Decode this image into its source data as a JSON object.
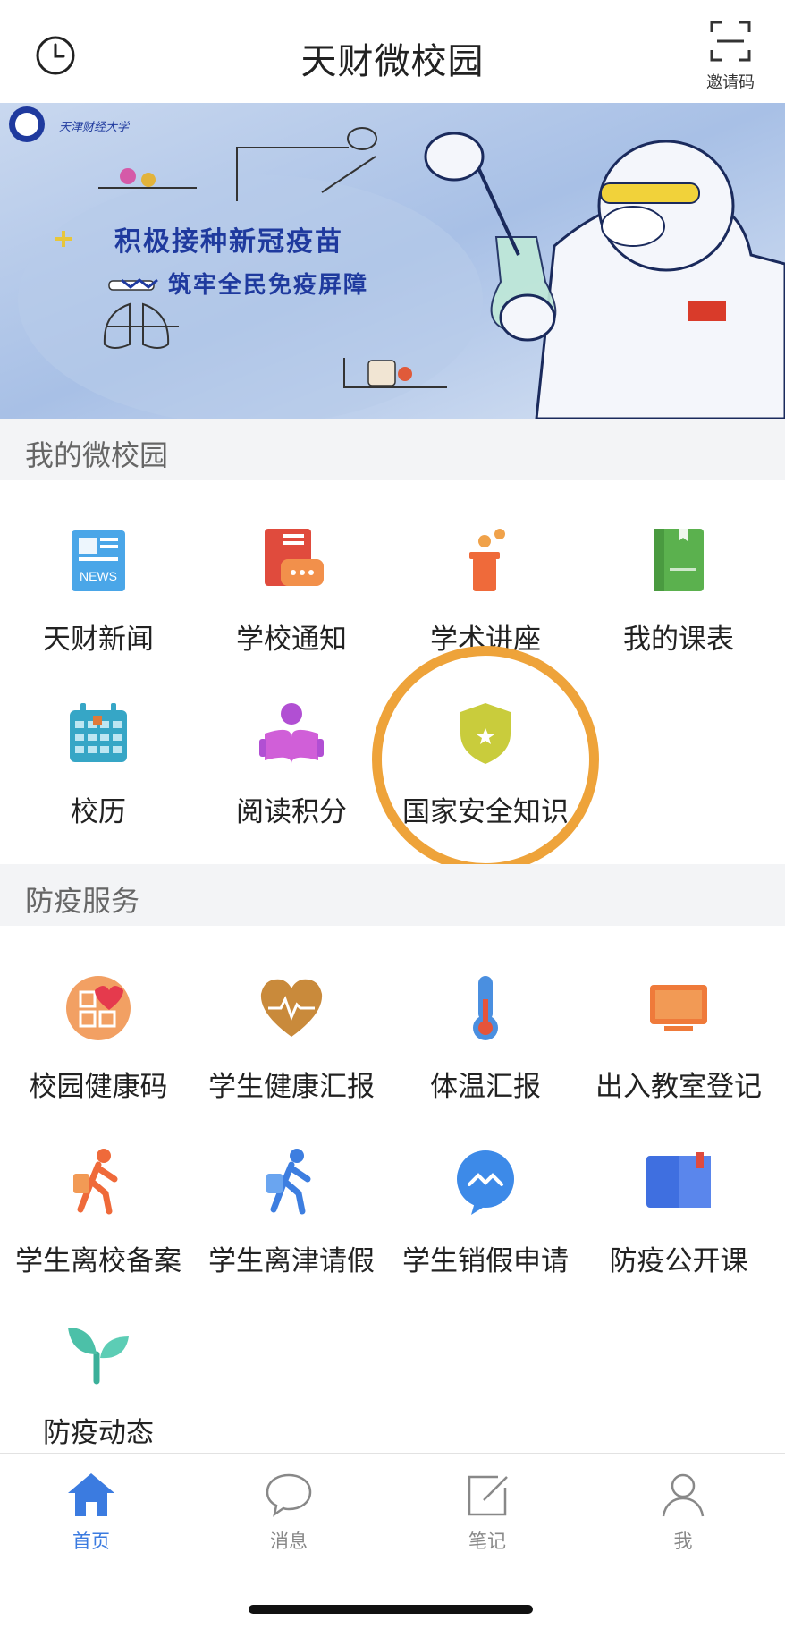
{
  "header": {
    "title": "天财微校园",
    "invite_label": "邀请码"
  },
  "banner": {
    "school_name": "天津财经大学",
    "line1": "积极接种新冠疫苗",
    "line2": "筑牢全民免疫屏障"
  },
  "sections": {
    "my_campus": "我的微校园",
    "epidemic": "防疫服务"
  },
  "my_campus_items": [
    {
      "label": "天财新闻"
    },
    {
      "label": "学校通知"
    },
    {
      "label": "学术讲座"
    },
    {
      "label": "我的课表"
    },
    {
      "label": "校历"
    },
    {
      "label": "阅读积分"
    },
    {
      "label": "国家安全知识"
    }
  ],
  "epidemic_items": [
    {
      "label": "校园健康码"
    },
    {
      "label": "学生健康汇报"
    },
    {
      "label": "体温汇报"
    },
    {
      "label": "出入教室登记"
    },
    {
      "label": "学生离校备案"
    },
    {
      "label": "学生离津请假"
    },
    {
      "label": "学生销假申请"
    },
    {
      "label": "防疫公开课"
    },
    {
      "label": "防疫动态"
    }
  ],
  "tabs": [
    {
      "label": "首页",
      "active": true
    },
    {
      "label": "消息"
    },
    {
      "label": "笔记"
    },
    {
      "label": "我"
    }
  ],
  "colors": {
    "accent": "#3b7be0",
    "highlight": "#eea33a"
  }
}
